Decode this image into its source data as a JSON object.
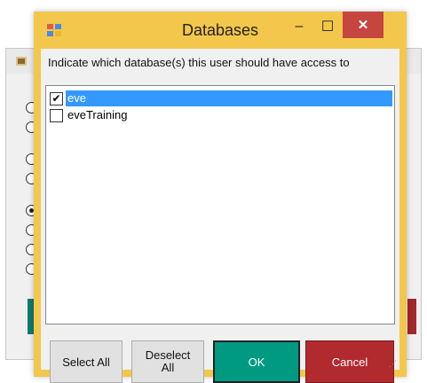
{
  "dialog": {
    "title": "Databases",
    "minimize_glyph": "–",
    "maximize_glyph": "☐",
    "close_glyph": "✕",
    "instruction": "Indicate which database(s) this user should have access to",
    "databases": [
      {
        "name": "eve",
        "checked": true,
        "selected": true,
        "check_glyph": "✔"
      },
      {
        "name": "eveTraining",
        "checked": false,
        "selected": false,
        "check_glyph": ""
      }
    ],
    "buttons": {
      "select_all": "Select All",
      "deselect_all_line1": "Deselect",
      "deselect_all_line2": "All",
      "ok": "OK",
      "cancel": "Cancel"
    }
  },
  "colors": {
    "frame": "#f3c74b",
    "close": "#c7453f",
    "ok": "#009a82",
    "cancel": "#b02a2e",
    "selection": "#3399ff"
  }
}
